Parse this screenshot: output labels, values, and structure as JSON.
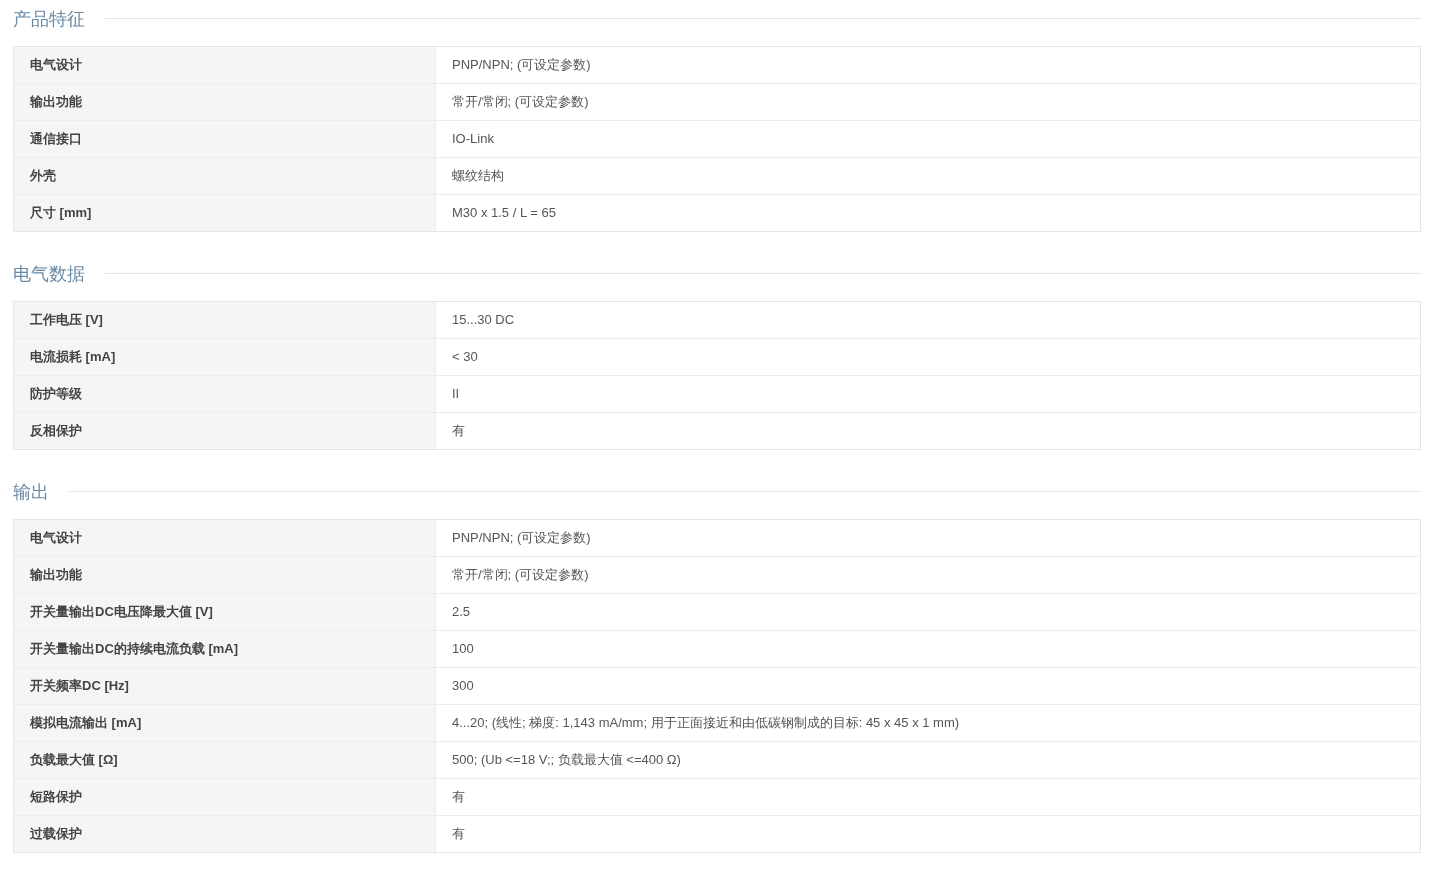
{
  "sections": [
    {
      "title": "产品特征",
      "rows": [
        {
          "label": "电气设计",
          "value": "PNP/NPN; (可设定参数)"
        },
        {
          "label": "输出功能",
          "value": "常开/常闭; (可设定参数)"
        },
        {
          "label": "通信接口",
          "value": "IO-Link"
        },
        {
          "label": "外壳",
          "value": "螺纹结构"
        },
        {
          "label": "尺寸 [mm]",
          "value": "M30 x 1.5 / L = 65"
        }
      ]
    },
    {
      "title": "电气数据",
      "rows": [
        {
          "label": "工作电压 [V]",
          "value": "15...30 DC"
        },
        {
          "label": "电流损耗 [mA]",
          "value": "< 30"
        },
        {
          "label": "防护等级",
          "value": "II"
        },
        {
          "label": "反相保护",
          "value": "有"
        }
      ]
    },
    {
      "title": "输出",
      "rows": [
        {
          "label": "电气设计",
          "value": "PNP/NPN; (可设定参数)"
        },
        {
          "label": "输出功能",
          "value": "常开/常闭; (可设定参数)"
        },
        {
          "label": "开关量输出DC电压降最大值 [V]",
          "value": "2.5"
        },
        {
          "label": "开关量输出DC的持续电流负载 [mA]",
          "value": "100"
        },
        {
          "label": "开关频率DC [Hz]",
          "value": "300"
        },
        {
          "label": "模拟电流输出 [mA]",
          "value": "4...20; (线性; 梯度: 1,143 mA/mm; 用于正面接近和由低碳钢制成的目标: 45 x 45 x 1 mm)"
        },
        {
          "label": "负载最大值 [Ω]",
          "value": "500; (Ub <=18 V;; 负载最大值 <=400 Ω)"
        },
        {
          "label": "短路保护",
          "value": "有"
        },
        {
          "label": "过载保护",
          "value": "有"
        }
      ]
    }
  ]
}
